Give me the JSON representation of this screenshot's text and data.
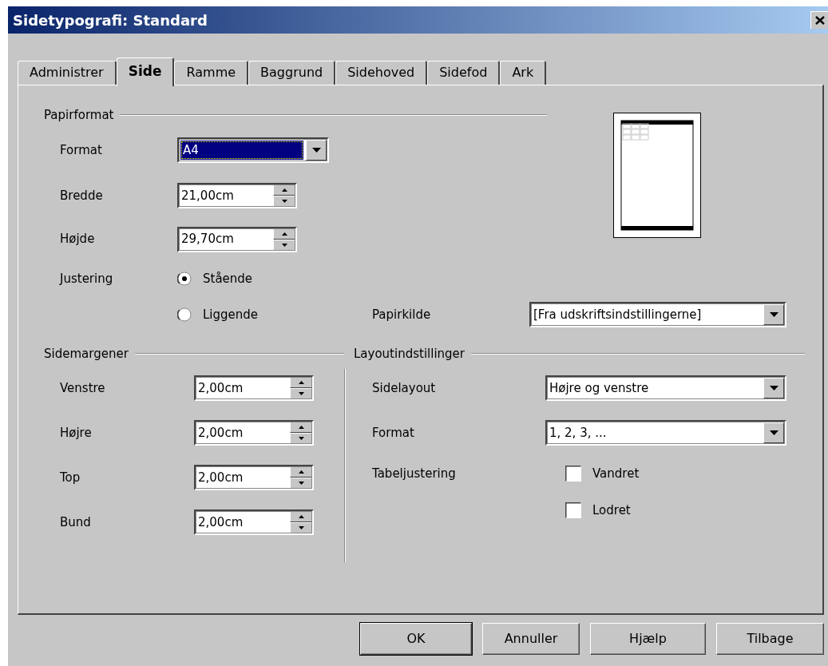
{
  "window": {
    "title": "Sidetypografi: Standard"
  },
  "tabs": [
    {
      "label": "Administrer",
      "selected": false
    },
    {
      "label": "Side",
      "selected": true
    },
    {
      "label": "Ramme",
      "selected": false
    },
    {
      "label": "Baggrund",
      "selected": false
    },
    {
      "label": "Sidehoved",
      "selected": false
    },
    {
      "label": "Sidefod",
      "selected": false
    },
    {
      "label": "Ark",
      "selected": false
    }
  ],
  "paper_format": {
    "legend": "Papirformat",
    "format": {
      "label": "Format",
      "value": "A4",
      "focused": true
    },
    "width": {
      "label": "Bredde",
      "value": "21,00cm"
    },
    "height": {
      "label": "Højde",
      "value": "29,70cm"
    },
    "orientation": {
      "label": "Justering",
      "options": [
        {
          "label": "Stående",
          "selected": true
        },
        {
          "label": "Liggende",
          "selected": false
        }
      ]
    },
    "paper_source": {
      "label": "Papirkilde",
      "value": "[Fra udskriftsindstillingerne]"
    }
  },
  "margins": {
    "legend": "Sidemargener",
    "fields": [
      {
        "label": "Venstre",
        "value": "2,00cm"
      },
      {
        "label": "Højre",
        "value": "2,00cm"
      },
      {
        "label": "Top",
        "value": "2,00cm"
      },
      {
        "label": "Bund",
        "value": "2,00cm"
      }
    ]
  },
  "layout": {
    "legend": "Layoutindstillinger",
    "page_layout": {
      "label": "Sidelayout",
      "value": "Højre og venstre"
    },
    "format": {
      "label": "Format",
      "value": "1, 2, 3, ..."
    },
    "table_alignment": {
      "label": "Tabeljustering",
      "options": [
        {
          "label": "Vandret",
          "checked": false
        },
        {
          "label": "Lodret",
          "checked": false
        }
      ]
    }
  },
  "buttons": [
    {
      "label": "OK",
      "default": true
    },
    {
      "label": "Annuller",
      "default": false
    },
    {
      "label": "Hjælp",
      "default": false
    },
    {
      "label": "Tilbage",
      "default": false
    }
  ]
}
